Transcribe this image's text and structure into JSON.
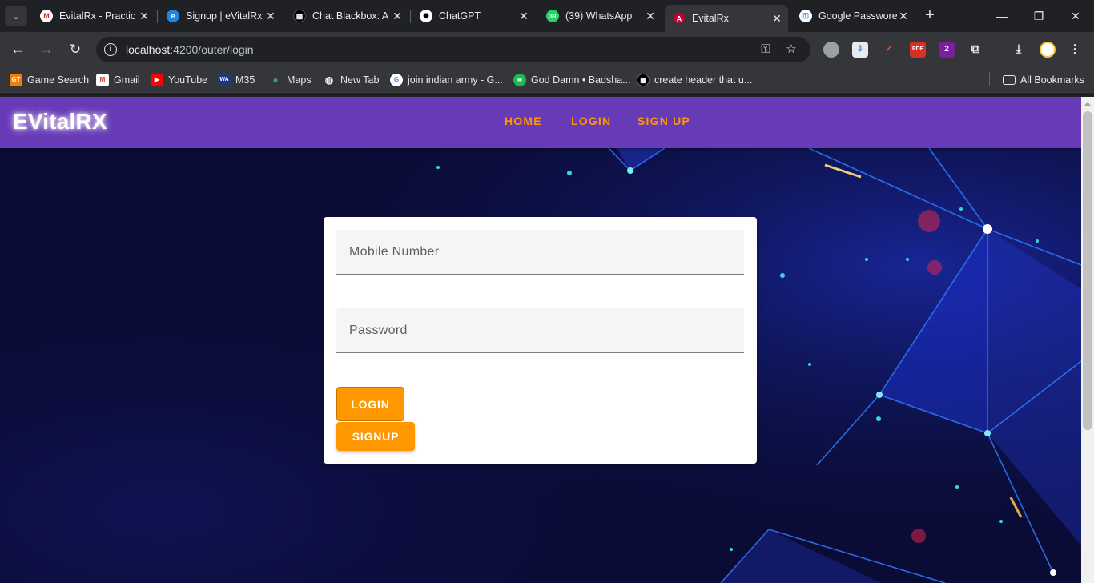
{
  "browser": {
    "tab_search_icon": "chevron-down-icon",
    "tabs": [
      {
        "title": "EvitalRx - Practic",
        "icon": "gmail-icon",
        "active": false
      },
      {
        "title": "Signup | eVitalRx",
        "icon": "evitalrx-icon",
        "active": false
      },
      {
        "title": "Chat Blackbox: A",
        "icon": "blackbox-icon",
        "active": false
      },
      {
        "title": "ChatGPT",
        "icon": "chatgpt-icon",
        "active": false
      },
      {
        "title": "(39) WhatsApp",
        "icon": "whatsapp-icon",
        "badge": "39",
        "active": false
      },
      {
        "title": "EvitalRx",
        "icon": "angular-icon",
        "active": true
      },
      {
        "title": "Google Passwore",
        "icon": "google-password-icon",
        "active": false
      }
    ],
    "new_tab_label": "+",
    "url_host": "localhost",
    "url_rest": ":4200/outer/login",
    "bookmarks": [
      {
        "label": "Game Search",
        "icon": "gt-icon",
        "icon_text": "GT"
      },
      {
        "label": "Gmail",
        "icon": "gmail-icon",
        "icon_text": "M"
      },
      {
        "label": "YouTube",
        "icon": "youtube-icon",
        "icon_text": "▶"
      },
      {
        "label": "M35",
        "icon": "wa-icon",
        "icon_text": "WA"
      },
      {
        "label": "Maps",
        "icon": "maps-icon",
        "icon_text": "●"
      },
      {
        "label": "New Tab",
        "icon": "globe-icon",
        "icon_text": "◍"
      },
      {
        "label": "join indian army - G...",
        "icon": "google-icon",
        "icon_text": "G"
      },
      {
        "label": "God Damn • Badsha...",
        "icon": "spotify-icon",
        "icon_text": "≋"
      },
      {
        "label": "create header that u...",
        "icon": "blackbox-icon",
        "icon_text": "▦"
      }
    ],
    "all_bookmarks_label": "All Bookmarks",
    "extensions": [
      {
        "icon": "extension-puzzle-icon",
        "text": ""
      },
      {
        "icon": "download-ext-icon",
        "text": "⇩"
      },
      {
        "icon": "vivaldi-ext-icon",
        "text": "✓"
      },
      {
        "icon": "pdf-ext-icon",
        "text": "PDF"
      },
      {
        "icon": "number-two-ext-icon",
        "text": "2"
      }
    ]
  },
  "app": {
    "brand": "EVitalRX",
    "nav": {
      "home": "HOME",
      "login": "LOGIN",
      "signup": "SIGN UP"
    },
    "form": {
      "mobile_placeholder": "Mobile Number",
      "password_placeholder": "Password",
      "login_button": "LOGIN",
      "signup_button": "SIGNUP"
    }
  },
  "colors": {
    "appbar": "#673ab7",
    "accent": "#ff9800",
    "page_background": "#0b0d3a"
  }
}
